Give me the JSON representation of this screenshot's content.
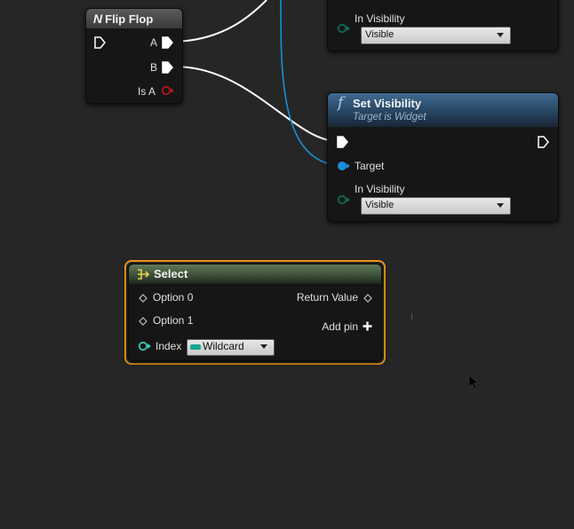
{
  "flip_flop": {
    "title": "Flip Flop",
    "pins": {
      "a": "A",
      "b": "B",
      "is_a": "Is A"
    }
  },
  "set_visibility_top": {
    "visibility_label": "In Visibility",
    "visibility_value": "Visible"
  },
  "set_visibility": {
    "title": "Set Visibility",
    "subtitle": "Target is Widget",
    "target_label": "Target",
    "visibility_label": "In Visibility",
    "visibility_value": "Visible"
  },
  "select": {
    "title": "Select",
    "option0": "Option 0",
    "option1": "Option 1",
    "index_label": "Index",
    "index_type": "Wildcard",
    "return_value": "Return Value",
    "add_pin": "Add pin"
  },
  "colors": {
    "background": "#262626",
    "exec_wire": "#ffffff",
    "object_wire": "#1a8fd8",
    "selection_outline": "#f09a1b",
    "bool_pin": "#a11a1a",
    "wildcard_pin": "#3ec9b5"
  },
  "icons": [
    "flip-flop-icon",
    "function-icon",
    "select-icon",
    "exec-pin-icon",
    "add-pin-icon",
    "mouse-cursor-icon"
  ]
}
